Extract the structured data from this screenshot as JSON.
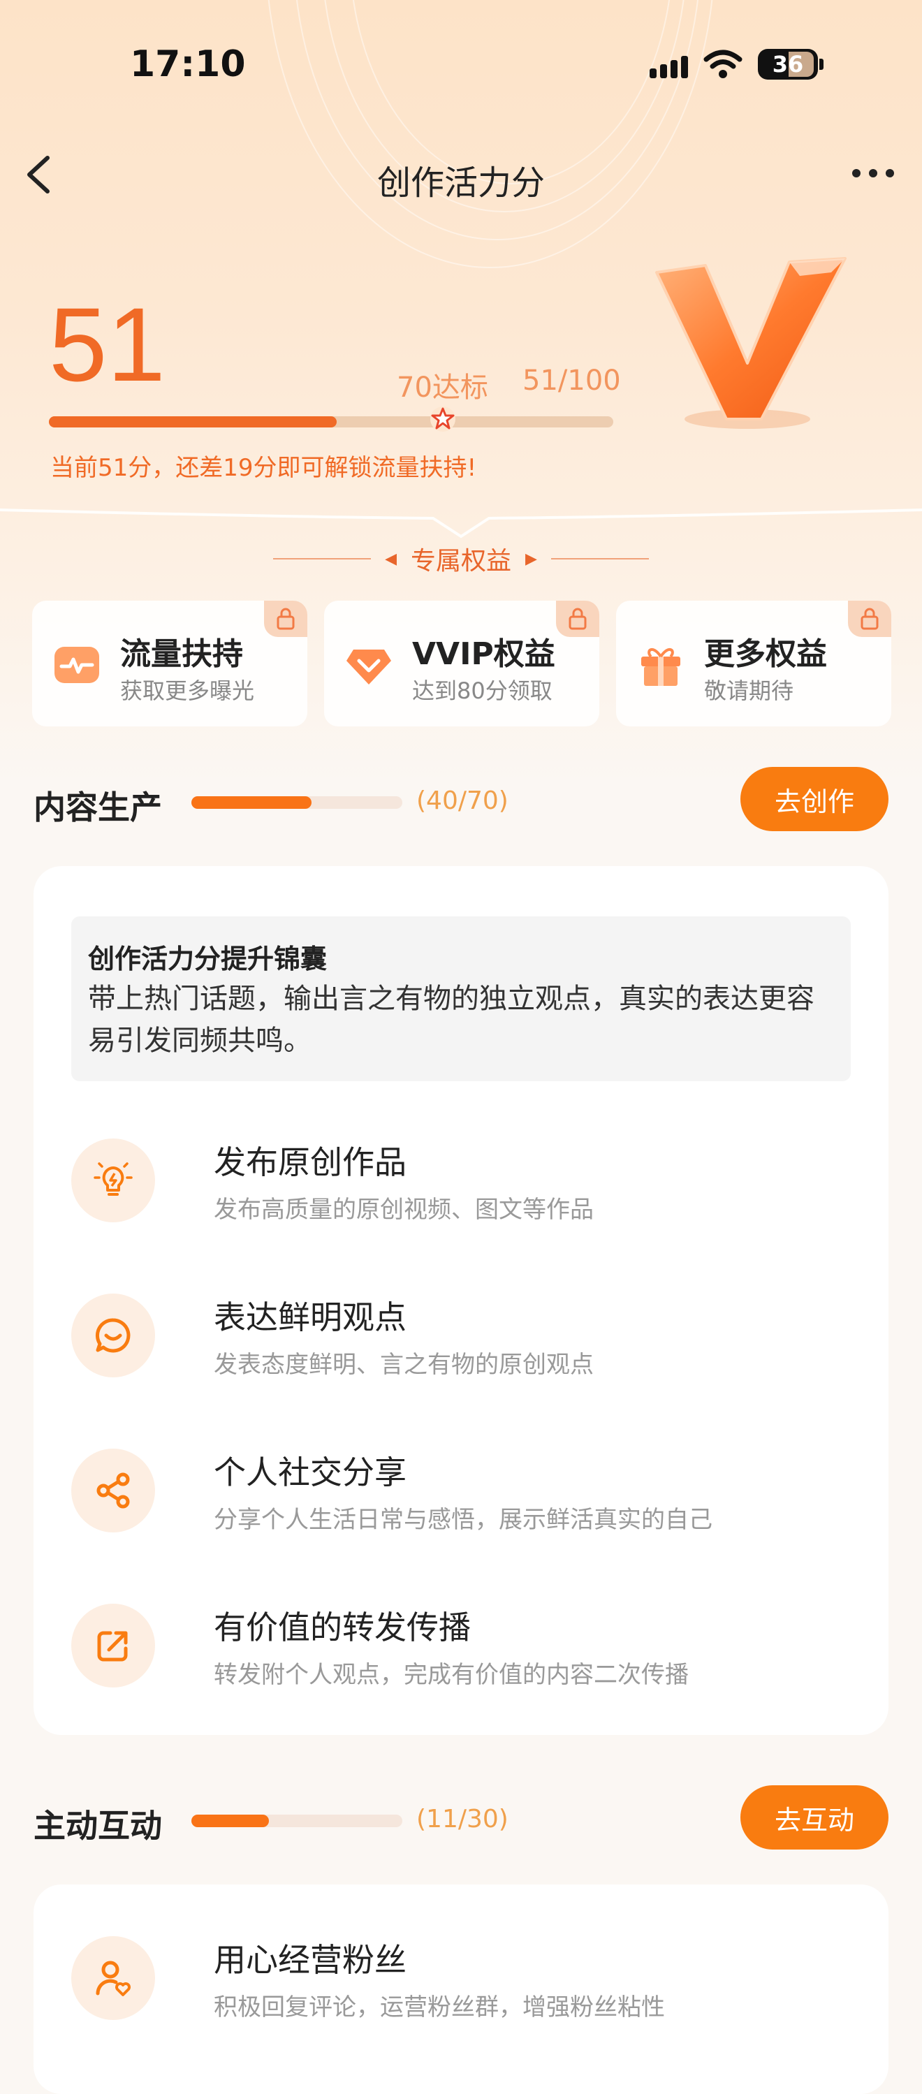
{
  "status": {
    "time": "17:10",
    "battery": "36"
  },
  "nav": {
    "title": "创作活力分"
  },
  "score": {
    "value": "51",
    "target_label": "70达标",
    "ratio": "51/100",
    "progress": 0.51,
    "tip": "当前51分，还差19分即可解锁流量扶持!"
  },
  "benefits": {
    "title": "专属权益",
    "items": [
      {
        "title": "流量扶持",
        "sub": "获取更多曝光",
        "icon": "traffic-icon"
      },
      {
        "title": "VVIP权益",
        "sub": "达到80分领取",
        "icon": "diamond-icon"
      },
      {
        "title": "更多权益",
        "sub": "敬请期待",
        "icon": "gift-icon"
      }
    ]
  },
  "content_section": {
    "title": "内容生产",
    "count": "(40/70)",
    "progress": 0.571,
    "button": "去创作",
    "tip_title": "创作活力分提升锦囊",
    "tip_body": "带上热门话题，输出言之有物的独立观点，真实的表达更容易引发同频共鸣。",
    "tasks": [
      {
        "title": "发布原创作品",
        "sub": "发布高质量的原创视频、图文等作品",
        "icon": "bulb-icon"
      },
      {
        "title": "表达鲜明观点",
        "sub": "发表态度鲜明、言之有物的原创观点",
        "icon": "chat-icon"
      },
      {
        "title": "个人社交分享",
        "sub": "分享个人生活日常与感悟，展示鲜活真实的自己",
        "icon": "share-icon"
      },
      {
        "title": "有价值的转发传播",
        "sub": "转发附个人观点，完成有价值的内容二次传播",
        "icon": "forward-icon"
      }
    ]
  },
  "interact_section": {
    "title": "主动互动",
    "count": "(11/30)",
    "progress": 0.367,
    "button": "去互动",
    "tasks": [
      {
        "title": "用心经营粉丝",
        "sub": "积极回复评论，运营粉丝群，增强粉丝粘性",
        "icon": "fans-icon"
      }
    ]
  },
  "colors": {
    "accent": "#f97c10",
    "score": "#f06a26",
    "hero_bg": "#fde3c8"
  }
}
